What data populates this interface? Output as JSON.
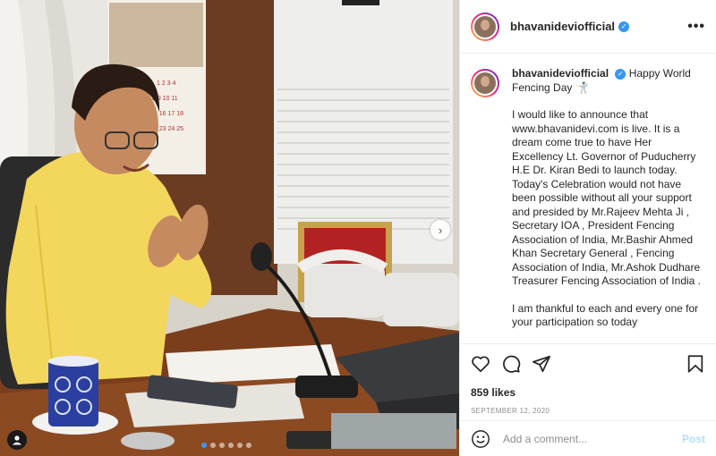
{
  "post": {
    "username": "bhavanideviofficial",
    "verified_icon": "verified-badge-icon",
    "more_icon": "more-options-icon",
    "caption": {
      "username": "bhavanideviofficial",
      "headline": "Happy World Fencing Day 🤺",
      "para1": "I would like to announce that www.bhavanidevi.com is live. It is a dream come true to have Her Excellency Lt. Governor of Puducherry H.E Dr. Kiran Bedi to launch today. Today's Celebration would not have been possible without all your support and presided by Mr.Rajeev Mehta Ji , Secretary IOA , President Fencing Association of India, Mr.Bashir Ahmed Khan Secretary General , Fencing Association of India, Mr.Ashok Dudhare Treasurer Fencing Association of India .",
      "para2": "I am thankful to each and every one for your participation so today"
    },
    "likes": "859 likes",
    "date": "SEPTEMBER 12, 2020",
    "comment": {
      "placeholder": "Add a comment...",
      "post_label": "Post"
    },
    "carousel": {
      "slides": 6,
      "active_index": 0
    },
    "colors": {
      "accent": "#3897f0",
      "post_disabled": "#b2dffc",
      "muted": "#8e8e8e"
    }
  }
}
